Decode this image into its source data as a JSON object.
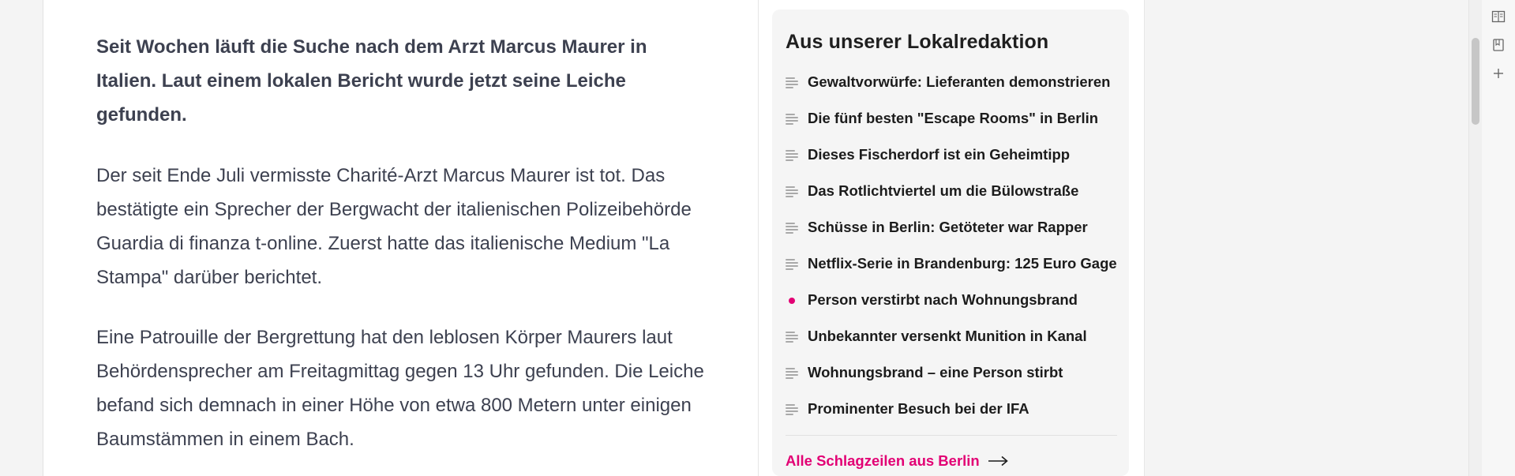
{
  "article": {
    "lead": "Seit Wochen läuft die Suche nach dem Arzt Marcus Maurer in Italien. Laut einem lokalen Bericht wurde jetzt seine Leiche gefunden.",
    "paragraphs": [
      "Der seit Ende Juli vermisste Charité-Arzt Marcus Maurer ist tot. Das bestätigte ein Sprecher der Bergwacht der italienischen Polizeibehörde Guardia di finanza t-online. Zuerst hatte das italienische Medium \"La Stampa\" darüber berichtet.",
      "Eine Patrouille der Bergrettung hat den leblosen Körper Maurers laut Behördensprecher am Freitagmittag gegen 13 Uhr gefunden. Die Leiche befand sich demnach in einer Höhe von etwa 800 Metern unter einigen Baumstämmen in einem Bach."
    ]
  },
  "sidebar": {
    "title": "Aus unserer Lokalredaktion",
    "items": [
      {
        "label": "Gewaltvorwürfe: Lieferanten demonstrieren",
        "icon": "article-lines-icon"
      },
      {
        "label": "Die fünf besten \"Escape Rooms\" in Berlin",
        "icon": "article-lines-icon"
      },
      {
        "label": "Dieses Fischerdorf ist ein Geheimtipp",
        "icon": "article-lines-icon"
      },
      {
        "label": "Das Rotlichtviertel um die Bülowstraße",
        "icon": "article-lines-icon"
      },
      {
        "label": "Schüsse in Berlin: Getöteter war Rapper",
        "icon": "article-lines-icon"
      },
      {
        "label": "Netflix-Serie in Brandenburg: 125 Euro Gage",
        "icon": "article-lines-icon"
      },
      {
        "label": "Person verstirbt nach Wohnungsbrand",
        "icon": "live-dot-icon"
      },
      {
        "label": "Unbekannter versenkt Munition in Kanal",
        "icon": "article-lines-icon"
      },
      {
        "label": "Wohnungsbrand – eine Person stirbt",
        "icon": "article-lines-icon"
      },
      {
        "label": "Prominenter Besuch bei der IFA",
        "icon": "article-lines-icon"
      }
    ],
    "all_link": "Alle Schlagzeilen aus Berlin"
  },
  "colors": {
    "accent": "#e20074",
    "text": "#3d4150",
    "box_bg": "#f5f5f5"
  },
  "side_tools": [
    "reader-view-icon",
    "bookmark-icon",
    "add-icon"
  ]
}
